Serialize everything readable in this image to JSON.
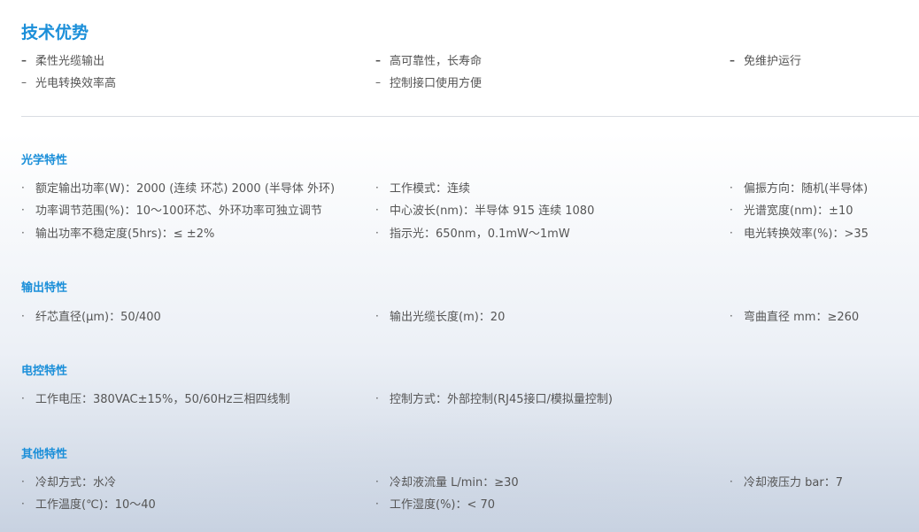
{
  "title": "技术优势",
  "advantages": [
    [
      "柔性光缆输出",
      "高可靠性，长寿命",
      "免维护运行"
    ],
    [
      "光电转换效率高",
      "控制接口使用方便",
      ""
    ]
  ],
  "sections": {
    "optical": {
      "title": "光学特性",
      "rows": [
        [
          "额定输出功率(W)：2000 (连续 环芯) 2000 (半导体 外环)",
          "工作模式：连续",
          "偏振方向：随机(半导体)"
        ],
        [
          "功率调节范围(%)：10～100环芯、外环功率可独立调节",
          "中心波长(nm)：半导体 915 连续 1080",
          "光谱宽度(nm)：±10"
        ],
        [
          "输出功率不稳定度(5hrs)：≤ ±2%",
          "指示光：650nm，0.1mW～1mW",
          "电光转换效率(%)：>35"
        ]
      ]
    },
    "output": {
      "title": "输出特性",
      "rows": [
        [
          "纤芯直径(μm)：50/400",
          "输出光缆长度(m)：20",
          "弯曲直径 mm：≥260"
        ]
      ]
    },
    "electric": {
      "title": "电控特性",
      "rows": [
        [
          "工作电压：380VAC±15%，50/60Hz三相四线制",
          "控制方式：外部控制(RJ45接口/模拟量控制)",
          ""
        ]
      ]
    },
    "other": {
      "title": "其他特性",
      "rows": [
        [
          "冷却方式：水冷",
          "冷却液流量 L/min：≥30",
          "冷却液压力 bar：7"
        ],
        [
          "工作温度(℃)：10～40",
          "工作湿度(%)：< 70",
          ""
        ]
      ]
    }
  },
  "markers": {
    "dash": "–",
    "dot": "·"
  }
}
